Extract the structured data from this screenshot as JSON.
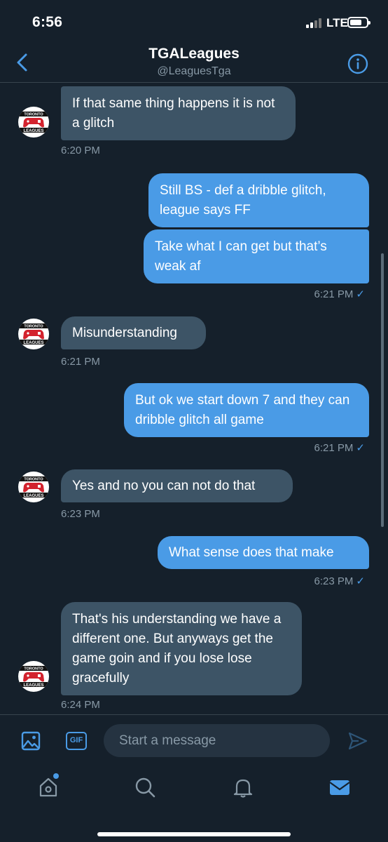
{
  "status_bar": {
    "time": "6:56",
    "network": "LTE"
  },
  "header": {
    "title": "TGALeagues",
    "handle": "@LeaguesTga"
  },
  "messages": [
    {
      "text": "If that same thing happens it is not a glitch",
      "time": "6:20 PM"
    },
    {
      "text": "Still BS - def a dribble glitch, league says FF"
    },
    {
      "text": "Take what I can get but that’s weak af",
      "time": "6:21 PM"
    },
    {
      "text": "Misunderstanding",
      "time": "6:21 PM"
    },
    {
      "text": "But ok we start down 7 and they can dribble glitch all game",
      "time": "6:21 PM"
    },
    {
      "text": "Yes and no you can not do that",
      "time": "6:23 PM"
    },
    {
      "text": "What sense does that make",
      "time": "6:23 PM"
    },
    {
      "text": "That's his understanding we have a different one. But anyways get the game goin and if you lose lose gracefully",
      "time": "6:24 PM"
    }
  ],
  "read_check": "✓",
  "avatar_text": {
    "top": "TORONTO",
    "bottom": "LEAGUES"
  },
  "composer": {
    "gif_label": "GIF",
    "placeholder": "Start a message"
  },
  "colors": {
    "background": "#15202b",
    "accent": "#4a9be6",
    "incoming_bubble": "#3d5466",
    "muted_text": "#8899a6"
  },
  "icons": [
    "back-chevron-icon",
    "info-icon",
    "image-icon",
    "gif-icon",
    "send-icon",
    "home-icon",
    "search-icon",
    "bell-icon",
    "mail-icon"
  ]
}
